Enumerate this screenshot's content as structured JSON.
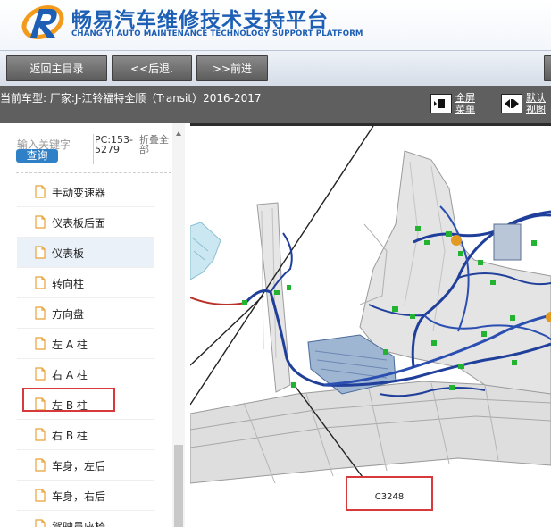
{
  "header": {
    "brand_cn": "畅易汽车维修技术支持平台",
    "brand_en": "CHANG YI AUTO MAINTENANCE TECHNOLOGY SUPPORT PLATFORM",
    "brand_color": "#1d5fb5",
    "logo_accent": "#f29a1c"
  },
  "toolbar": {
    "home_label": "返回主目录",
    "back_label": "<<后退.",
    "forward_label": ">>前进"
  },
  "infobar": {
    "vehicle_text": "当前车型:  厂家:J-江铃福特全顺（Transit）2016-2017",
    "fullscreen_label_1": "全屏",
    "fullscreen_label_2": "菜单",
    "default_view_label_1": "默认",
    "default_view_label_2": "视图"
  },
  "sidebar": {
    "search_placeholder": "输入关键字",
    "query_label": "查询",
    "pc_text": "PC:153-5279",
    "fold_text": "折叠全部",
    "items": [
      {
        "label": "手动变速器"
      },
      {
        "label": "仪表板后面"
      },
      {
        "label": "仪表板"
      },
      {
        "label": "转向柱"
      },
      {
        "label": "方向盘"
      },
      {
        "label": "左 A 柱"
      },
      {
        "label": "右 A 柱"
      },
      {
        "label": "左 B 柱"
      },
      {
        "label": "右 B 柱"
      },
      {
        "label": "车身，左后"
      },
      {
        "label": "车身，右后"
      },
      {
        "label": "驾驶员座椅"
      }
    ],
    "selected_index": 2,
    "highlighted_index": 7
  },
  "diagram": {
    "connector_label": "C3248",
    "highlight_color": "#d63a3a"
  }
}
